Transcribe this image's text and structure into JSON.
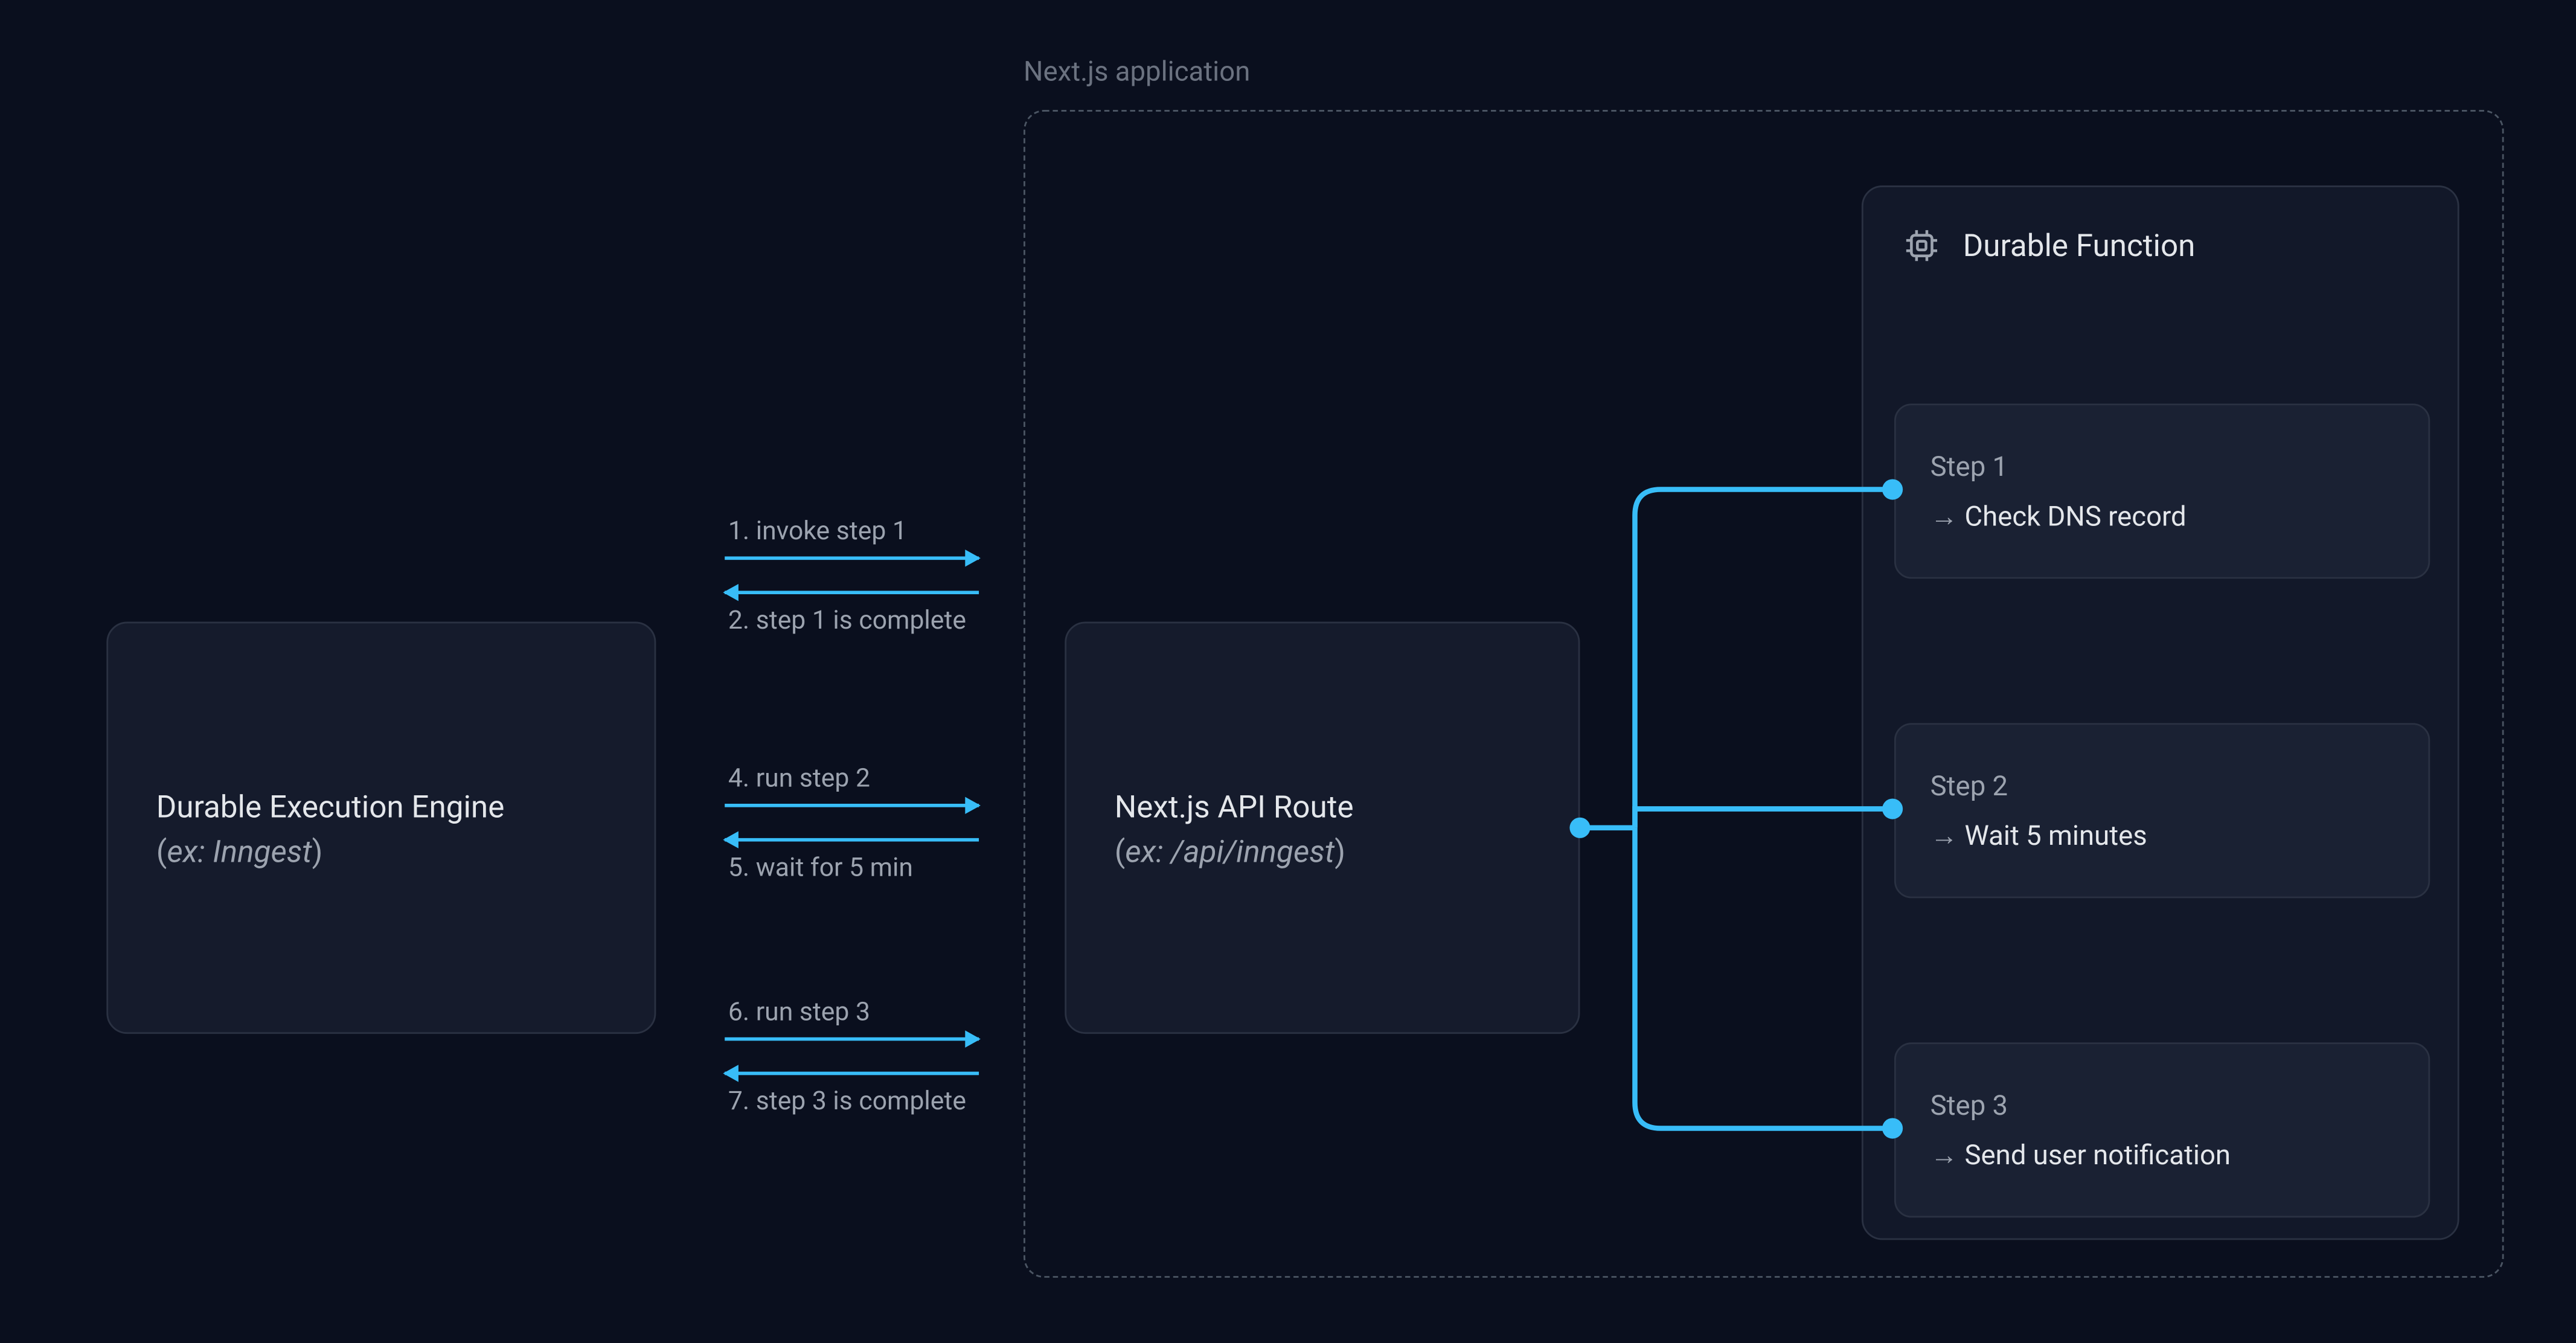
{
  "app_label": "Next.js application",
  "engine": {
    "title": "Durable Execution Engine",
    "example_prefix": "ex: ",
    "example": "Inngest"
  },
  "api": {
    "title": "Next.js API Route",
    "example_prefix": "ex: ",
    "example": "/api/inngest"
  },
  "durable_function": {
    "title": "Durable Function",
    "steps": [
      {
        "label": "Step 1",
        "desc": "Check DNS record"
      },
      {
        "label": "Step 2",
        "desc": "Wait 5 minutes"
      },
      {
        "label": "Step 3",
        "desc": "Send user notification"
      }
    ]
  },
  "messages": [
    {
      "n": "1",
      "text": "invoke step 1",
      "dir": "right"
    },
    {
      "n": "2",
      "text": "step 1 is complete",
      "dir": "left"
    },
    {
      "n": "4",
      "text": "run step 2",
      "dir": "right"
    },
    {
      "n": "5",
      "text": "wait for 5 min",
      "dir": "left"
    },
    {
      "n": "6",
      "text": "run step 3",
      "dir": "right"
    },
    {
      "n": "7",
      "text": "step 3 is complete",
      "dir": "left"
    }
  ],
  "colors": {
    "accent": "#38bdf8",
    "background": "#0a0f1e"
  },
  "arrow_glyph": "→"
}
